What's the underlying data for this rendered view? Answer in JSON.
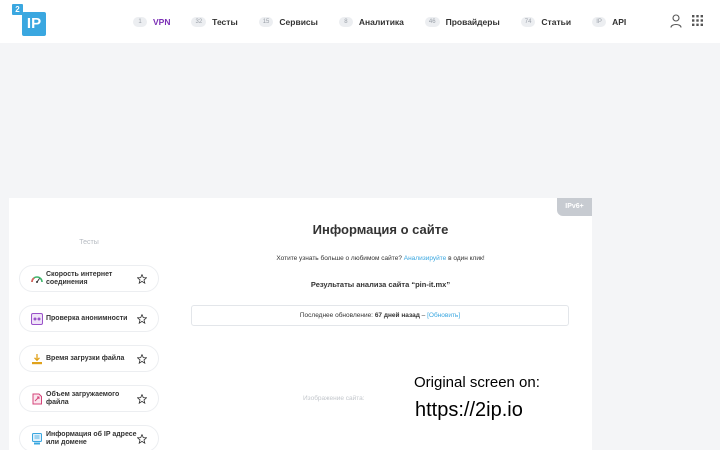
{
  "logo": {
    "sup": "2",
    "main": "IP"
  },
  "nav": [
    {
      "badge": "1",
      "label": "VPN",
      "active": true
    },
    {
      "badge": "32",
      "label": "Тесты"
    },
    {
      "badge": "15",
      "label": "Сервисы"
    },
    {
      "badge": "8",
      "label": "Аналитика"
    },
    {
      "badge": "46",
      "label": "Провайдеры"
    },
    {
      "badge": "74",
      "label": "Статьи"
    },
    {
      "badge": "IP",
      "label": "API"
    }
  ],
  "sidebar": {
    "title": "Тесты",
    "tools": [
      {
        "label": "Скорость интернет соединения",
        "icon": "speedometer-icon"
      },
      {
        "label": "Проверка анонимности",
        "icon": "anonymity-icon"
      },
      {
        "label": "Время загрузки файла",
        "icon": "download-icon"
      },
      {
        "label": "Объем загружаемого файла",
        "icon": "file-size-icon"
      },
      {
        "label": "Информация об IP адресе или домене",
        "icon": "ip-info-icon"
      }
    ]
  },
  "content": {
    "badge": "IPv6+",
    "title": "Информация о сайте",
    "lead_prefix": "Хотите узнать больше о любимом сайте?",
    "lead_link": "Анализируйте",
    "lead_suffix": "в один клик!",
    "results": "Результаты анализа сайта “pin-it.mx”",
    "update_prefix": "Последнее обновление:",
    "update_value": "67 дней назад",
    "update_sep": "–",
    "update_refresh": "[Обновить]",
    "image_label": "Изображение сайта:"
  },
  "watermark": {
    "line1": "Original screen on:",
    "line2": "https://2ip.io"
  },
  "colors": {
    "accent": "#3aa7e0",
    "active_nav": "#7b2fb5",
    "background": "#f4f5f7"
  }
}
